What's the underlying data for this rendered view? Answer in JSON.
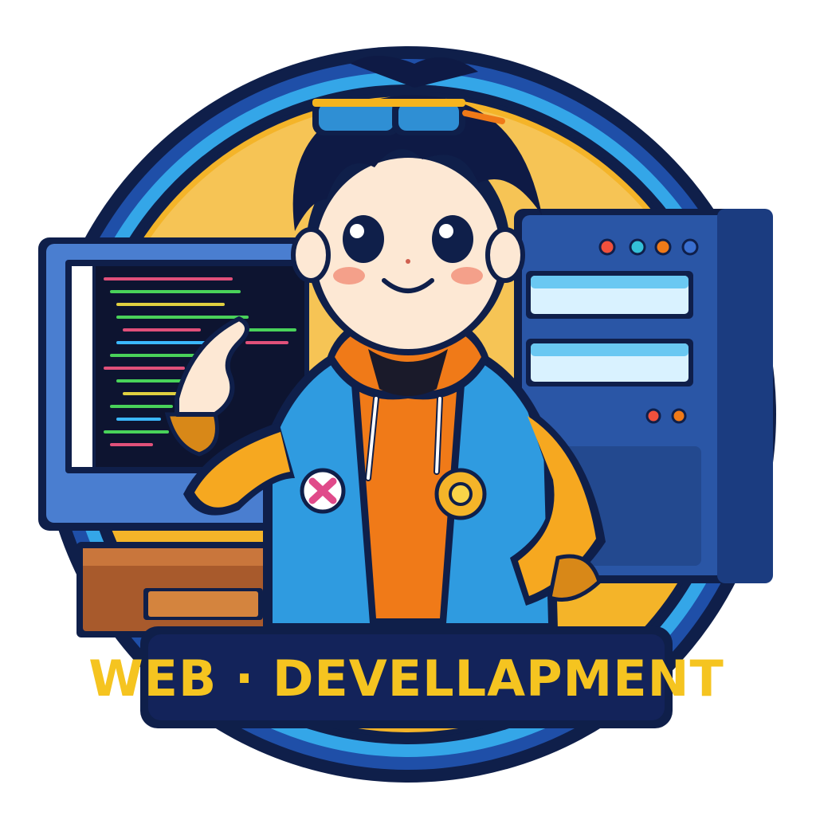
{
  "banner": {
    "text": "WEB · DEVELLAPMENT"
  },
  "colors": {
    "outline": "#0f1f4a",
    "ring": "#1f4fa8",
    "ring_light": "#34a6e8",
    "sun": "#f4b429",
    "sky": "#f7d27a",
    "monitor": "#3c6ec2",
    "screen": "#0f1631",
    "server": "#264c96",
    "jacket_blue": "#2f9be0",
    "sleeve_yellow": "#f6a820",
    "hoodie_orange": "#f07a18",
    "skin": "#fde8d4",
    "hair": "#0e1a45",
    "glasses_frame": "#f5b41e",
    "glasses_lens": "#2f8fd4",
    "desk": "#a85a2c",
    "banner_bg": "#0f1f4a",
    "banner_text": "#f5c420"
  },
  "icons": {
    "character": "developer-avatar-icon",
    "monitor": "computer-monitor-icon",
    "server": "server-rack-icon",
    "patch_left": "bandage-patch-icon",
    "patch_right": "sun-gear-patch-icon",
    "glasses": "goggles-icon"
  }
}
